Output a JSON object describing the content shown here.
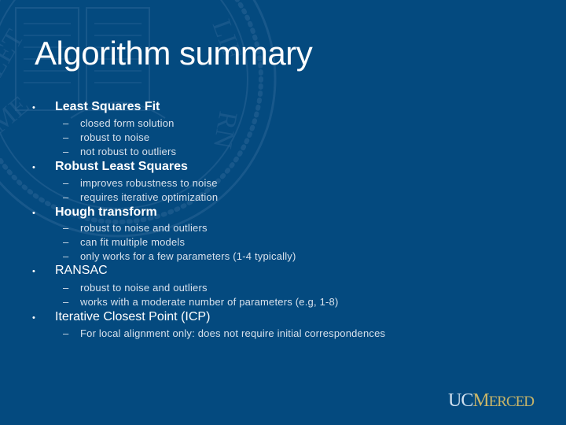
{
  "slide": {
    "title": "Algorithm summary",
    "colors": {
      "background": "#044a7f",
      "title": "#ffffff",
      "sub_text": "#d7e1ec",
      "logo_uc": "#cfe0ef",
      "logo_merced": "#c9b568"
    },
    "items": [
      {
        "label": "Least Squares Fit",
        "subitems": [
          "closed form solution",
          "robust to noise",
          "not robust to outliers"
        ]
      },
      {
        "label": "Robust Least Squares",
        "subitems": [
          "improves robustness to noise",
          "requires iterative optimization"
        ]
      },
      {
        "label": "Hough transform",
        "subitems": [
          "robust to noise and outliers",
          "can fit multiple models",
          "only works for a few parameters (1-4 typically)"
        ]
      },
      {
        "label": "RANSAC",
        "subitems": [
          "robust to noise and outliers",
          "works with a moderate number of parameters (e.g, 1-8)"
        ]
      },
      {
        "label": "Iterative Closest Point (ICP)",
        "subitems": [
          "For local alignment only: does not require initial correspondences"
        ]
      }
    ],
    "bullet_glyph": "•",
    "dash_glyph": "–",
    "logo": {
      "uc": "UC",
      "merced_first": "M",
      "merced_rest": "ERCED"
    }
  }
}
